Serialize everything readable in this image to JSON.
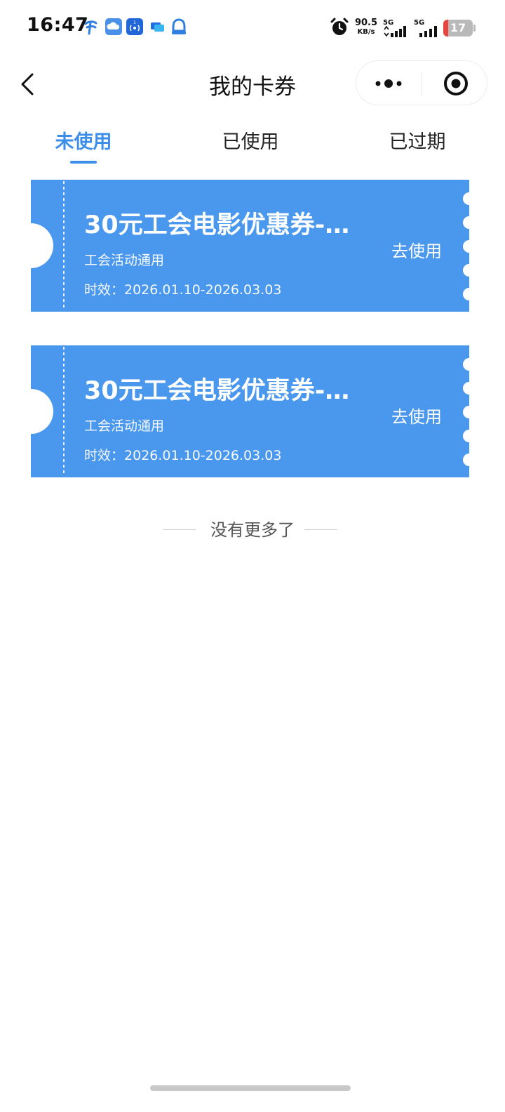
{
  "status_bar": {
    "time": "16:47",
    "net_speed_value": "90.5",
    "net_speed_unit": "KB/s",
    "signal_1_label": "5G",
    "signal_2_label": "5G",
    "battery_level": "17",
    "battery_fraction": 0.17
  },
  "nav": {
    "title": "我的卡券"
  },
  "tabs": [
    {
      "label": "未使用"
    },
    {
      "label": "已使用"
    },
    {
      "label": "已过期"
    }
  ],
  "coupons": [
    {
      "title": "30元工会电影优惠券-…",
      "scope": "工会活动通用",
      "validity": "时效：2026.01.10-2026.03.03",
      "action": "去使用"
    },
    {
      "title": "30元工会电影优惠券-…",
      "scope": "工会活动通用",
      "validity": "时效：2026.01.10-2026.03.03",
      "action": "去使用"
    }
  ],
  "list_end_text": "没有更多了",
  "colors": {
    "accent": "#3d8ee8",
    "coupon_bg": "#4a97ee",
    "battery_low": "#e8453c"
  }
}
